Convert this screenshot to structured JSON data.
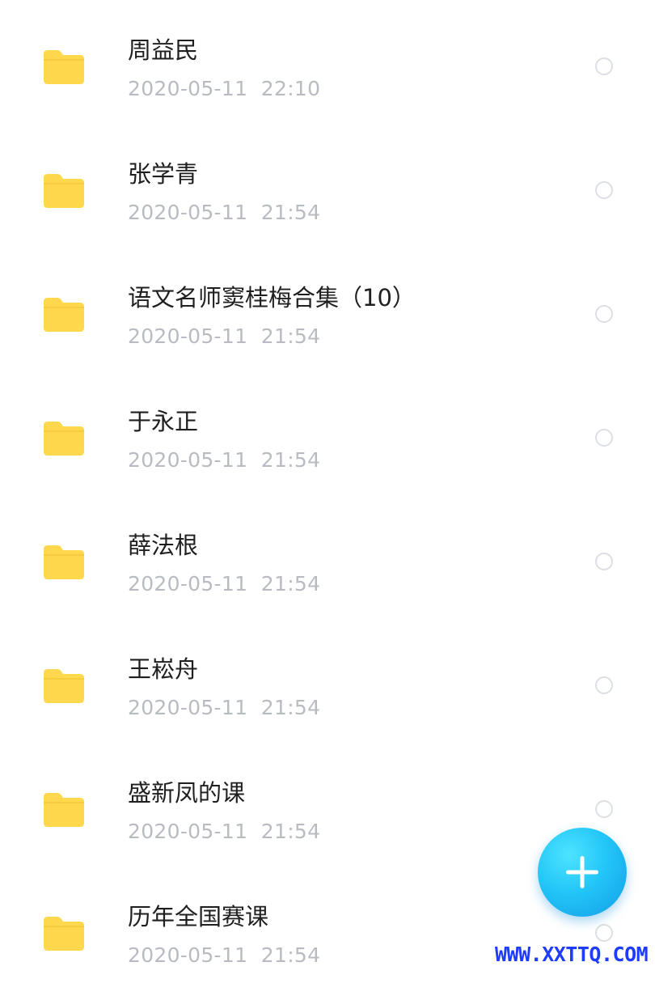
{
  "files": [
    {
      "name": "周益民",
      "date": "2020-05-11  22:10"
    },
    {
      "name": "张学青",
      "date": "2020-05-11  21:54"
    },
    {
      "name": "语文名师窦桂梅合集（10）",
      "date": "2020-05-11  21:54"
    },
    {
      "name": "于永正",
      "date": "2020-05-11  21:54"
    },
    {
      "name": "薛法根",
      "date": "2020-05-11  21:54"
    },
    {
      "name": "王崧舟",
      "date": "2020-05-11  21:54"
    },
    {
      "name": "盛新凤的课",
      "date": "2020-05-11  21:54"
    },
    {
      "name": "历年全国赛课",
      "date": "2020-05-11  21:54"
    }
  ],
  "icons": {
    "folder": "folder-icon",
    "select": "radio-circle",
    "add": "plus-icon"
  },
  "colors": {
    "folder": "#FFD84D",
    "fab": "#22C6F7",
    "watermark": "#1E3CFF"
  },
  "watermark": "WWW.XXTTQ.COM"
}
